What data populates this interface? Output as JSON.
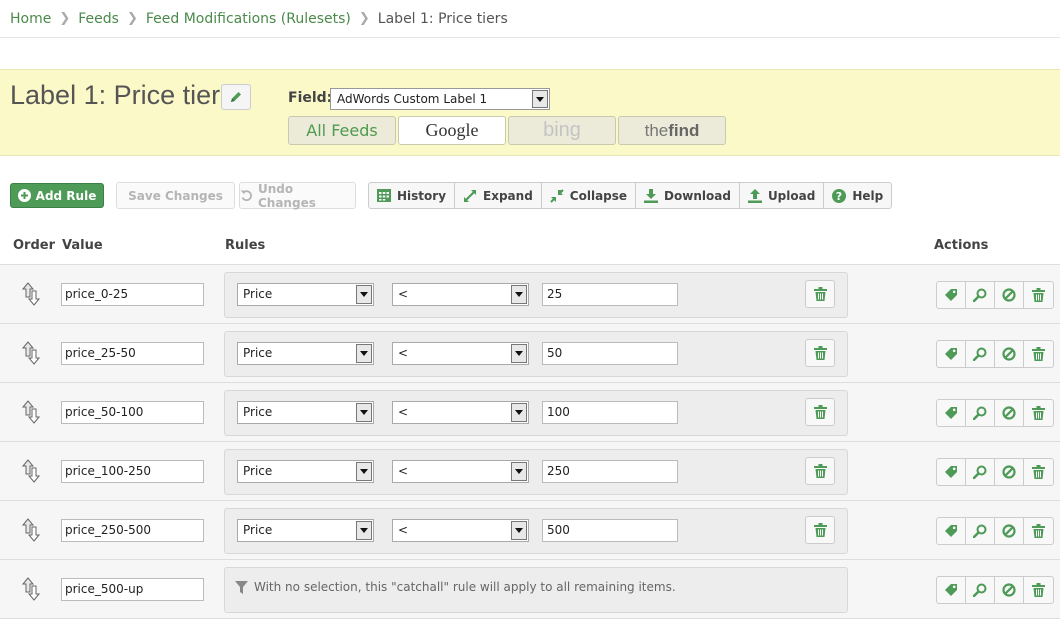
{
  "breadcrumb": {
    "items": [
      "Home",
      "Feeds",
      "Feed Modifications (Rulesets)"
    ],
    "current": "Label 1: Price tiers"
  },
  "header": {
    "title": "Label 1: Price tiers",
    "field_label": "Field:",
    "field_value": "AdWords Custom Label 1",
    "tabs": [
      {
        "label": "All Feeds"
      },
      {
        "label": "Google"
      },
      {
        "label": "bing"
      },
      {
        "label_a": "the",
        "label_b": "find"
      }
    ]
  },
  "toolbar": {
    "add_rule": "Add Rule",
    "save_changes": "Save Changes",
    "undo_changes": "Undo Changes",
    "history": "History",
    "expand": "Expand",
    "collapse": "Collapse",
    "download": "Download",
    "upload": "Upload",
    "help": "Help"
  },
  "table": {
    "headers": {
      "order": "Order",
      "value": "Value",
      "rules": "Rules",
      "actions": "Actions"
    },
    "rows": [
      {
        "value": "price_0-25",
        "field": "Price",
        "operator": "<",
        "operand": "25"
      },
      {
        "value": "price_25-50",
        "field": "Price",
        "operator": "<",
        "operand": "50"
      },
      {
        "value": "price_50-100",
        "field": "Price",
        "operator": "<",
        "operand": "100"
      },
      {
        "value": "price_100-250",
        "field": "Price",
        "operator": "<",
        "operand": "250"
      },
      {
        "value": "price_250-500",
        "field": "Price",
        "operator": "<",
        "operand": "500"
      },
      {
        "value": "price_500-up",
        "catchall": "With no selection, this \"catchall\" rule will apply to all remaining items."
      }
    ]
  },
  "colors": {
    "accent_green": "#4e9a57",
    "header_band": "#fbf9c7",
    "link": "#4a8a4a"
  }
}
